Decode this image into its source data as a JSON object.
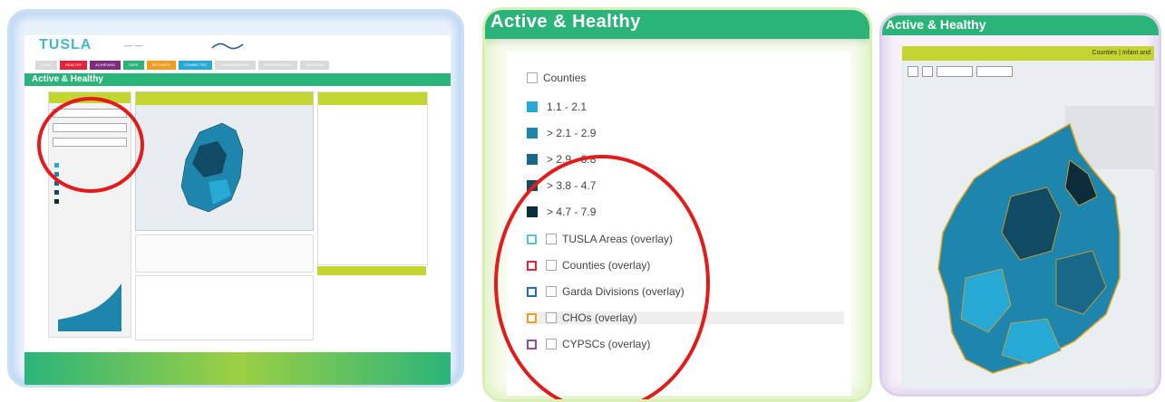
{
  "panel1": {
    "logo": "TUSLA",
    "logo_sub": "",
    "partner_logo": "",
    "nav": [
      {
        "label": "HOME",
        "color": "#d9d9d9"
      },
      {
        "label": "HEALTHY",
        "color": "#e3233a"
      },
      {
        "label": "ACHIEVING",
        "color": "#7d2d7c"
      },
      {
        "label": "SAFE",
        "color": "#2bb47a"
      },
      {
        "label": "SECURITY",
        "color": "#f49c20"
      },
      {
        "label": "CONNECTED",
        "color": "#27a9d6"
      },
      {
        "label": "DEMOGRAPHICS",
        "color": "#d9d9d9"
      },
      {
        "label": "PERFORMANCE",
        "color": "#d9d9d9"
      },
      {
        "label": "SERVICES",
        "color": "#d9d9d9"
      }
    ],
    "section_title": "Active & Healthy"
  },
  "panel2": {
    "title": "Active & Healthy",
    "layer_label": "Counties",
    "classes": [
      {
        "label": "1.1 - 2.1",
        "color": "#27a9d6"
      },
      {
        "label": "> 2.1 - 2.9",
        "color": "#1e86ad"
      },
      {
        "label": "> 2.9 - 3.8",
        "color": "#18688a"
      },
      {
        "label": "> 3.8 - 4.7",
        "color": "#114a63"
      },
      {
        "label": "> 4.7 - 7.9",
        "color": "#0b2c3b"
      }
    ],
    "overlays": [
      {
        "label": "TUSLA Areas (overlay)",
        "color": "#5bc7c4"
      },
      {
        "label": "Counties (overlay)",
        "color": "#e3233a"
      },
      {
        "label": "Garda Divisions (overlay)",
        "color": "#1e6fb8"
      },
      {
        "label": "CHOs (overlay)",
        "color": "#f49c20"
      },
      {
        "label": "CYPSCs (overlay)",
        "color": "#8b4fa6"
      }
    ]
  },
  "panel3": {
    "title": "Active & Healthy",
    "subtitle": "Counties | Infant and"
  },
  "colors": {
    "brand_green": "#2bb47a",
    "lime": "#c2d531",
    "highlight_red": "#e21b1b"
  }
}
